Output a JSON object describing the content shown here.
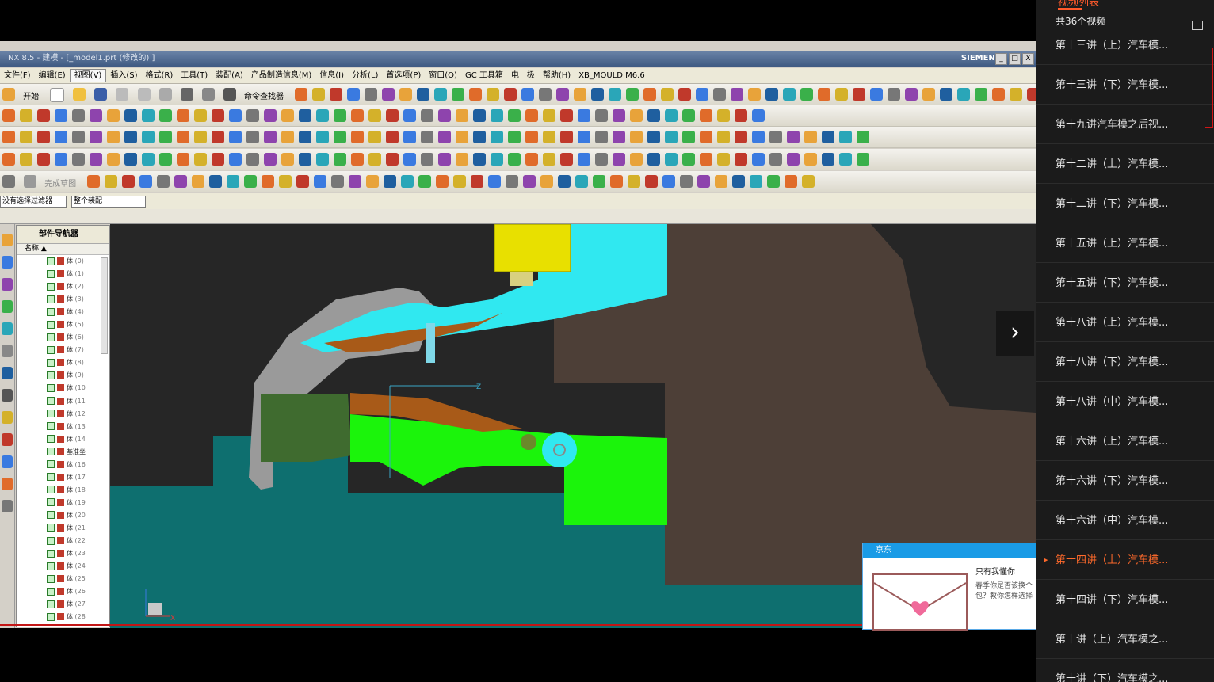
{
  "ghost_menu": [
    "文件(F)",
    "编辑(E)",
    "视图(V)",
    "插入(S)",
    "格式(R)",
    "工具(T)",
    "装配(A)",
    "产品制造信息(M)",
    "信息(I)",
    "分析(L)",
    "首选项(P)",
    "窗口(O)",
    "GC 工具箱",
    "电",
    "极",
    "帮助(H)",
    "XB_MOULD M6.6"
  ],
  "window": {
    "title": "NX 8.5 - 建模 - [_model1.prt (修改的) ]",
    "brand": "SIEMENS",
    "minimize": "_",
    "maximize": "□",
    "close": "X"
  },
  "menubar": [
    "文件(F)",
    "编辑(E)",
    "视图(V)",
    "插入(S)",
    "格式(R)",
    "工具(T)",
    "装配(A)",
    "产品制造信息(M)",
    "信息(I)",
    "分析(L)",
    "首选项(P)",
    "窗口(O)",
    "GC 工具箱",
    "电",
    "极",
    "帮助(H)",
    "XB_MOULD M6.6"
  ],
  "toolbar": {
    "start_label": "开始",
    "command_finder": "命令查找器",
    "finish_sketch": "完成草图"
  },
  "filters": {
    "selection_filter": "没有选择过滤器",
    "assembly_scope": "整个装配"
  },
  "navigator": {
    "title": "部件导航器",
    "column": "名称",
    "rows": [
      {
        "name": "体",
        "index": "(0)"
      },
      {
        "name": "体",
        "index": "(1)"
      },
      {
        "name": "体",
        "index": "(2)"
      },
      {
        "name": "体",
        "index": "(3)"
      },
      {
        "name": "体",
        "index": "(4)"
      },
      {
        "name": "体",
        "index": "(5)"
      },
      {
        "name": "体",
        "index": "(6)"
      },
      {
        "name": "体",
        "index": "(7)"
      },
      {
        "name": "体",
        "index": "(8)"
      },
      {
        "name": "体",
        "index": "(9)"
      },
      {
        "name": "体",
        "index": "(10"
      },
      {
        "name": "体",
        "index": "(11"
      },
      {
        "name": "体",
        "index": "(12"
      },
      {
        "name": "体",
        "index": "(13"
      },
      {
        "name": "体",
        "index": "(14"
      },
      {
        "name": "基准坐",
        "index": ""
      },
      {
        "name": "体",
        "index": "(16"
      },
      {
        "name": "体",
        "index": "(17"
      },
      {
        "name": "体",
        "index": "(18"
      },
      {
        "name": "体",
        "index": "(19"
      },
      {
        "name": "体",
        "index": "(20"
      },
      {
        "name": "体",
        "index": "(21"
      },
      {
        "name": "体",
        "index": "(22"
      },
      {
        "name": "体",
        "index": "(23"
      },
      {
        "name": "体",
        "index": "(24"
      },
      {
        "name": "体",
        "index": "(25"
      },
      {
        "name": "体",
        "index": "(26"
      },
      {
        "name": "体",
        "index": "(27"
      },
      {
        "name": "体",
        "index": "(28"
      }
    ]
  },
  "viewport": {
    "axis_labels": {
      "z": "Z",
      "x": "X"
    }
  },
  "popup": {
    "header": "京东",
    "title": "只有我懂你",
    "body": "春季你是否该换个包？教你怎样选择"
  },
  "player": {
    "next_label": "›"
  },
  "sidebar": {
    "top_tab": "视频列表",
    "count_label": "共36个视频",
    "items": [
      {
        "title": "第十三讲（上）汽车模...",
        "active": false
      },
      {
        "title": "第十三讲（下）汽车模...",
        "active": false
      },
      {
        "title": "第十九讲汽车模之后视...",
        "active": false
      },
      {
        "title": "第十二讲（上）汽车模...",
        "active": false
      },
      {
        "title": "第十二讲（下）汽车模...",
        "active": false
      },
      {
        "title": "第十五讲（上）汽车模...",
        "active": false
      },
      {
        "title": "第十五讲（下）汽车模...",
        "active": false
      },
      {
        "title": "第十八讲（上）汽车模...",
        "active": false
      },
      {
        "title": "第十八讲（下）汽车模...",
        "active": false
      },
      {
        "title": "第十八讲（中）汽车模...",
        "active": false
      },
      {
        "title": "第十六讲（上）汽车模...",
        "active": false
      },
      {
        "title": "第十六讲（下）汽车模...",
        "active": false
      },
      {
        "title": "第十六讲（中）汽车模...",
        "active": false
      },
      {
        "title": "第十四讲（上）汽车模...",
        "active": true
      },
      {
        "title": "第十四讲（下）汽车模...",
        "active": false
      },
      {
        "title": "第十讲（上）汽车模之...",
        "active": false
      },
      {
        "title": "第十讲（下）汽车模之...",
        "active": false
      }
    ]
  },
  "colors": {
    "accent": "#ff6a2b",
    "viewport_bg": "#262626",
    "sidebar_bg": "#1b1b1b"
  }
}
